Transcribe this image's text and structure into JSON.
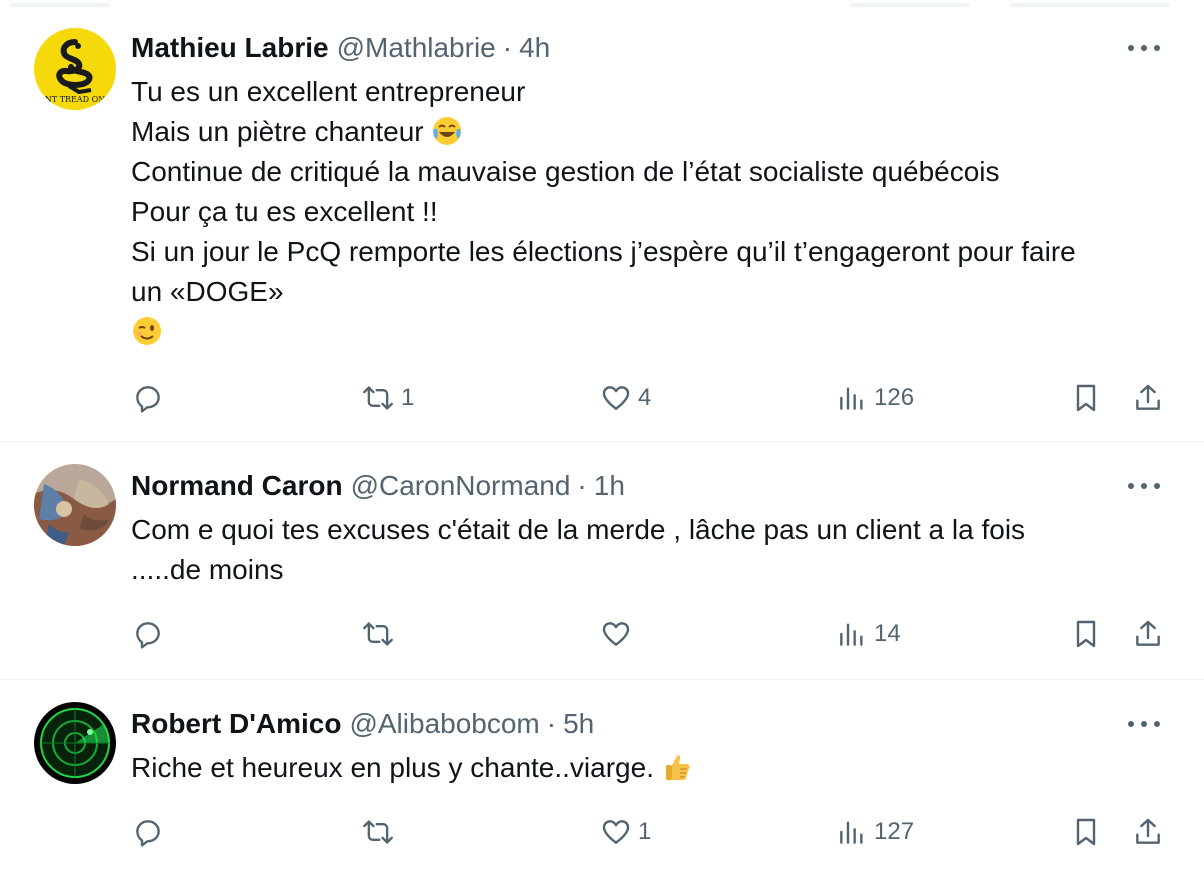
{
  "replies": [
    {
      "name": "Mathieu Labrie",
      "handle": "@Mathlabrie",
      "separator": "·",
      "time": "4h",
      "avatar_text": "NT TREAD ON",
      "lines": [
        "Tu es un excellent entrepreneur",
        "Mais un piètre chanteur",
        "Continue de critiqué la mauvaise gestion de l’état socialiste québécois",
        "Pour ça tu es excellent !!",
        "Si un jour le PcQ remporte les élections j’espère qu’il t’engageront pour faire",
        "un «DOGE»"
      ],
      "emojis": [
        "tears-of-joy-emoji",
        "winking-face-emoji"
      ],
      "reposts": "1",
      "likes": "4",
      "views": "126"
    },
    {
      "name": "Normand Caron",
      "handle": "@CaronNormand",
      "separator": "·",
      "time": "1h",
      "lines": [
        "Com e quoi tes excuses c'était de la merde , lâche pas un client a la fois",
        ".....de moins"
      ],
      "reposts": "",
      "likes": "",
      "views": "14"
    },
    {
      "name": "Robert D'Amico",
      "handle": "@Alibabobcom",
      "separator": "·",
      "time": "5h",
      "lines": [
        "Riche et heureux en plus y chante..viarge."
      ],
      "emojis": [
        "thumbs-up-emoji"
      ],
      "reposts": "",
      "likes": "1",
      "views": "127"
    }
  ],
  "colors": {
    "text_primary": "#0f1419",
    "text_secondary": "#536471",
    "divider": "#eff3f4",
    "avatar_yellow": "#f5d90a"
  },
  "icons": [
    "reply-icon",
    "repost-icon",
    "like-icon",
    "views-icon",
    "bookmark-icon",
    "share-icon",
    "more-icon"
  ]
}
